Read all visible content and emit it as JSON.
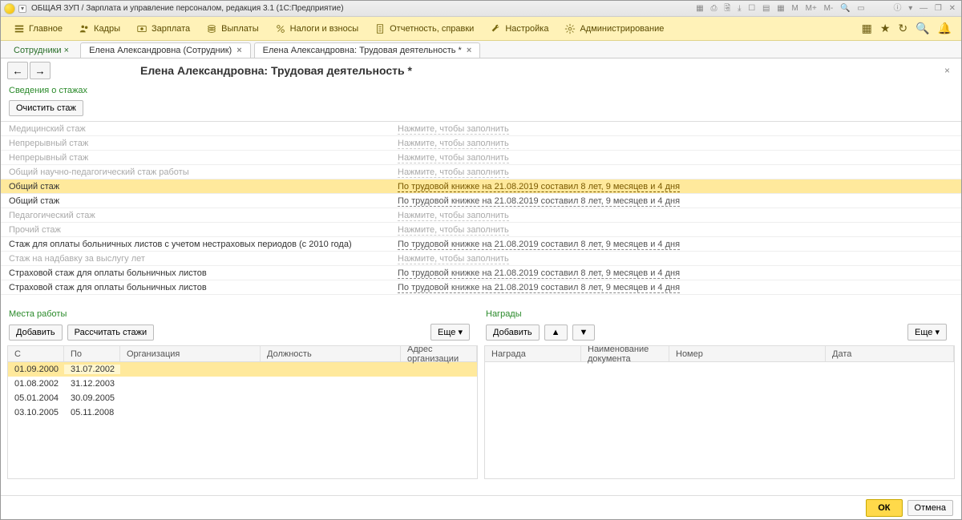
{
  "title_bar": "ОБЩАЯ ЗУП / Зарплата и управление персоналом, редакция 3.1  (1С:Предприятие)",
  "menu": {
    "main": "Главное",
    "kadry": "Кадры",
    "zarplata": "Зарплата",
    "vyplaty": "Выплаты",
    "nalogi": "Налоги и взносы",
    "otchet": "Отчетность, справки",
    "nastroika": "Настройка",
    "admin": "Администрирование"
  },
  "crumb": "Сотрудники",
  "tabs": {
    "t1": "Елена Александровна (Сотрудник)",
    "t2": "Елена Александровна: Трудовая деятельность *"
  },
  "page_title": "Елена Александровна: Трудовая деятельность *",
  "section_stazh": "Сведения о стажах",
  "btn_clear": "Очистить стаж",
  "fill_hint": "Нажмите, чтобы заполнить",
  "stazh_value": "По трудовой книжке на 21.08.2019 составил 8 лет, 9 месяцев и 4 дня",
  "rows": {
    "r0": "Медицинский стаж",
    "r1": "Непрерывный стаж",
    "r2": "Непрерывный стаж",
    "r3": "Общий научно-педагогический стаж работы",
    "r4": "Общий стаж",
    "r5": "Общий стаж",
    "r6": "Педагогический стаж",
    "r7": "Прочий стаж",
    "r8": "Стаж для оплаты больничных листов с учетом нестраховых периодов (с 2010 года)",
    "r9": "Стаж на надбавку за выслугу лет",
    "r10": "Страховой стаж для оплаты больничных листов",
    "r11": "Страховой стаж для оплаты больничных листов"
  },
  "section_places": "Места работы",
  "section_awards": "Награды",
  "btn_add": "Добавить",
  "btn_calc": "Рассчитать стажи",
  "btn_more": "Еще",
  "places_head": {
    "c0": "С",
    "c1": "По",
    "c2": "Организация",
    "c3": "Должность",
    "c4": "Адрес организации"
  },
  "places": [
    {
      "from": "01.09.2000",
      "to": "31.07.2002"
    },
    {
      "from": "01.08.2002",
      "to": "31.12.2003"
    },
    {
      "from": "05.01.2004",
      "to": "30.09.2005"
    },
    {
      "from": "03.10.2005",
      "to": "05.11.2008"
    }
  ],
  "awards_head": {
    "c0": "Награда",
    "c1": "Наименование документа",
    "c2": "Номер",
    "c3": "Дата"
  },
  "footer": {
    "ok": "ОК",
    "cancel": "Отмена"
  },
  "tb_letters": {
    "m": "M",
    "mp": "M+",
    "mm": "M-"
  }
}
